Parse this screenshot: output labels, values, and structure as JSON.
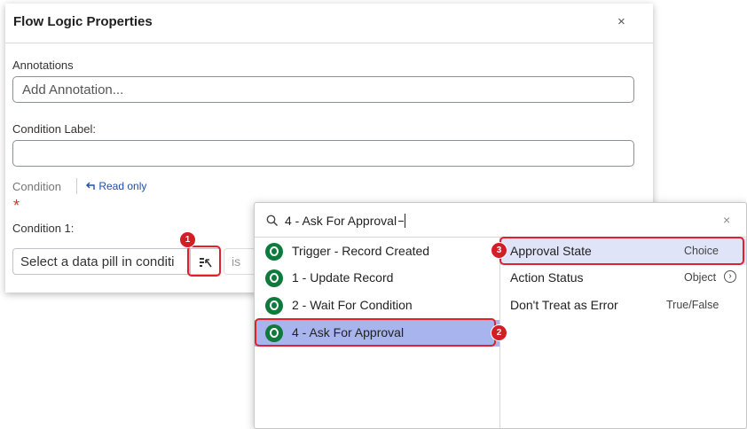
{
  "panel": {
    "title": "Flow Logic Properties",
    "close_glyph": "×",
    "annotations_label": "Annotations",
    "annotation_placeholder": "Add Annotation...",
    "condition_label_label": "Condition Label:",
    "condition_label_value": "",
    "condition_label": "Condition",
    "read_only_label": "Read only",
    "read_only_icon": "undo-arrow-icon",
    "required_marker": "*",
    "condition1_label": "Condition 1:",
    "pill_input_text": "Select a data pill in conditi",
    "pill_picker_icon": "data-pill-picker-icon",
    "operator_text": "is"
  },
  "callouts": {
    "badge1": "1",
    "badge2": "2",
    "badge3": "3",
    "color": "#e0202a"
  },
  "popup": {
    "search_value": "4 - Ask For Approval",
    "search_icon": "search-icon",
    "close_glyph": "×",
    "items": [
      {
        "label": "Trigger - Record Created"
      },
      {
        "label": "1 - Update Record"
      },
      {
        "label": "2 - Wait For Condition"
      },
      {
        "label": "4 - Ask For Approval"
      }
    ],
    "selected_item_color": "#a7b4ee",
    "fields": [
      {
        "name": "Approval State",
        "type": "Choice"
      },
      {
        "name": "Action Status",
        "type": "Object"
      },
      {
        "name": "Don't Treat as Error",
        "type": "True/False"
      }
    ]
  }
}
